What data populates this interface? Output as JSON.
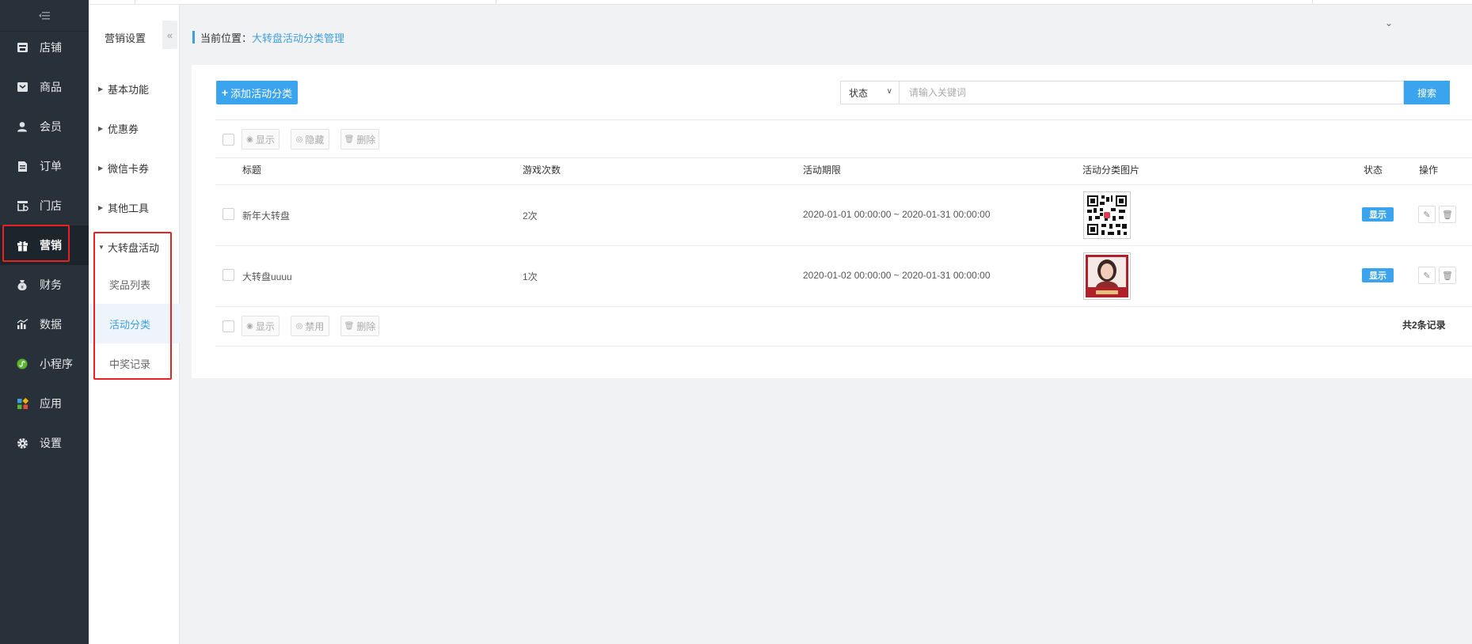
{
  "sidebar": {
    "toggle_icon": "menu-collapse-icon",
    "items": [
      {
        "label": "店铺",
        "icon": "store-icon"
      },
      {
        "label": "商品",
        "icon": "product-icon"
      },
      {
        "label": "会员",
        "icon": "member-icon"
      },
      {
        "label": "订单",
        "icon": "order-icon"
      },
      {
        "label": "门店",
        "icon": "shop-icon"
      },
      {
        "label": "营销",
        "icon": "gift-icon",
        "active": true
      },
      {
        "label": "财务",
        "icon": "money-bag-icon"
      },
      {
        "label": "数据",
        "icon": "chart-icon"
      },
      {
        "label": "小程序",
        "icon": "mini-program-icon"
      },
      {
        "label": "应用",
        "icon": "apps-icon"
      },
      {
        "label": "设置",
        "icon": "gear-icon"
      }
    ]
  },
  "subnav": {
    "title": "营销设置",
    "collapse_glyph": "«",
    "groups": [
      {
        "label": "基本功能",
        "expanded": false
      },
      {
        "label": "优惠券",
        "expanded": false
      },
      {
        "label": "微信卡券",
        "expanded": false
      },
      {
        "label": "其他工具",
        "expanded": false
      },
      {
        "label": "大转盘活动",
        "expanded": true
      }
    ],
    "sub_items": [
      {
        "label": "奖品列表"
      },
      {
        "label": "活动分类",
        "active": true
      },
      {
        "label": "中奖记录"
      }
    ]
  },
  "breadcrumb": {
    "prefix": "当前位置：",
    "current": "大转盘活动分类管理"
  },
  "toolbar": {
    "add_label": "添加活动分类",
    "status_label": "状态",
    "search_placeholder": "请输入关键词",
    "search_label": "搜索"
  },
  "batch_top": {
    "show_label": "显示",
    "hide_label": "隐藏",
    "delete_label": "删除"
  },
  "batch_bottom": {
    "show_label": "显示",
    "disable_label": "禁用",
    "delete_label": "删除"
  },
  "table": {
    "headers": [
      "标题",
      "游戏次数",
      "活动期限",
      "活动分类图片",
      "状态",
      "操作"
    ],
    "rows": [
      {
        "title": "新年大转盘",
        "plays": "2次",
        "period": "2020-01-01 00:00:00 ~ 2020-01-31 00:00:00",
        "image": "qr-code-image",
        "status": "显示"
      },
      {
        "title": "大转盘uuuu",
        "plays": "1次",
        "period": "2020-01-02 00:00:00 ~ 2020-01-31 00:00:00",
        "image": "portrait-poster-image",
        "status": "显示"
      }
    ]
  },
  "footer": {
    "total": "共2条记录"
  },
  "colors": {
    "accent": "#3ba4ee",
    "sidebar_bg": "#283139",
    "highlight_box": "#e82222"
  }
}
